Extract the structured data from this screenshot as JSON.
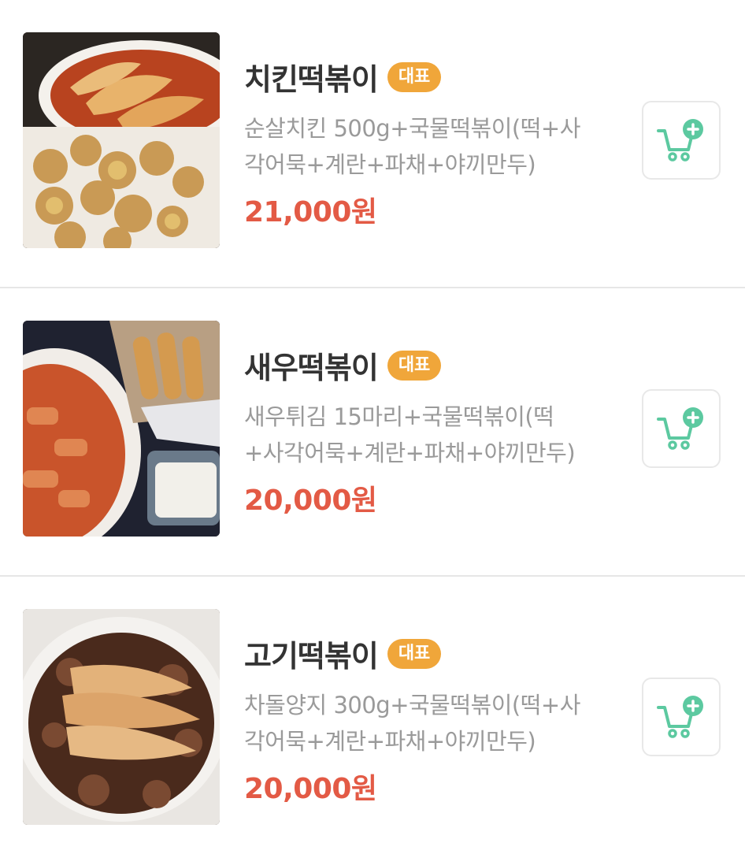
{
  "menu": {
    "items": [
      {
        "name": "치킨떡볶이",
        "badge": "대표",
        "description": "순살치킨 500g+국물떡볶이(떡+사각어묵+계란+파채+야끼만두)",
        "price": "21,000원",
        "image_icon": "chicken-tteokbokki-photo"
      },
      {
        "name": "새우떡볶이",
        "badge": "대표",
        "description": "새우튀김 15마리+국물떡볶이(떡+사각어묵+계란+파채+야끼만두)",
        "price": "20,000원",
        "image_icon": "shrimp-tteokbokki-photo"
      },
      {
        "name": "고기떡볶이",
        "badge": "대표",
        "description": "차돌양지 300g+국물떡볶이(떡+사각어묵+계란+파채+야끼만두)",
        "price": "20,000원",
        "image_icon": "beef-tteokbokki-photo"
      }
    ]
  },
  "colors": {
    "badge": "#f0a63a",
    "price": "#e35a45",
    "cart_icon": "#5cc9a0",
    "title": "#333333",
    "description": "#9a9a9a"
  },
  "icons": {
    "cart": "cart-plus-icon"
  }
}
